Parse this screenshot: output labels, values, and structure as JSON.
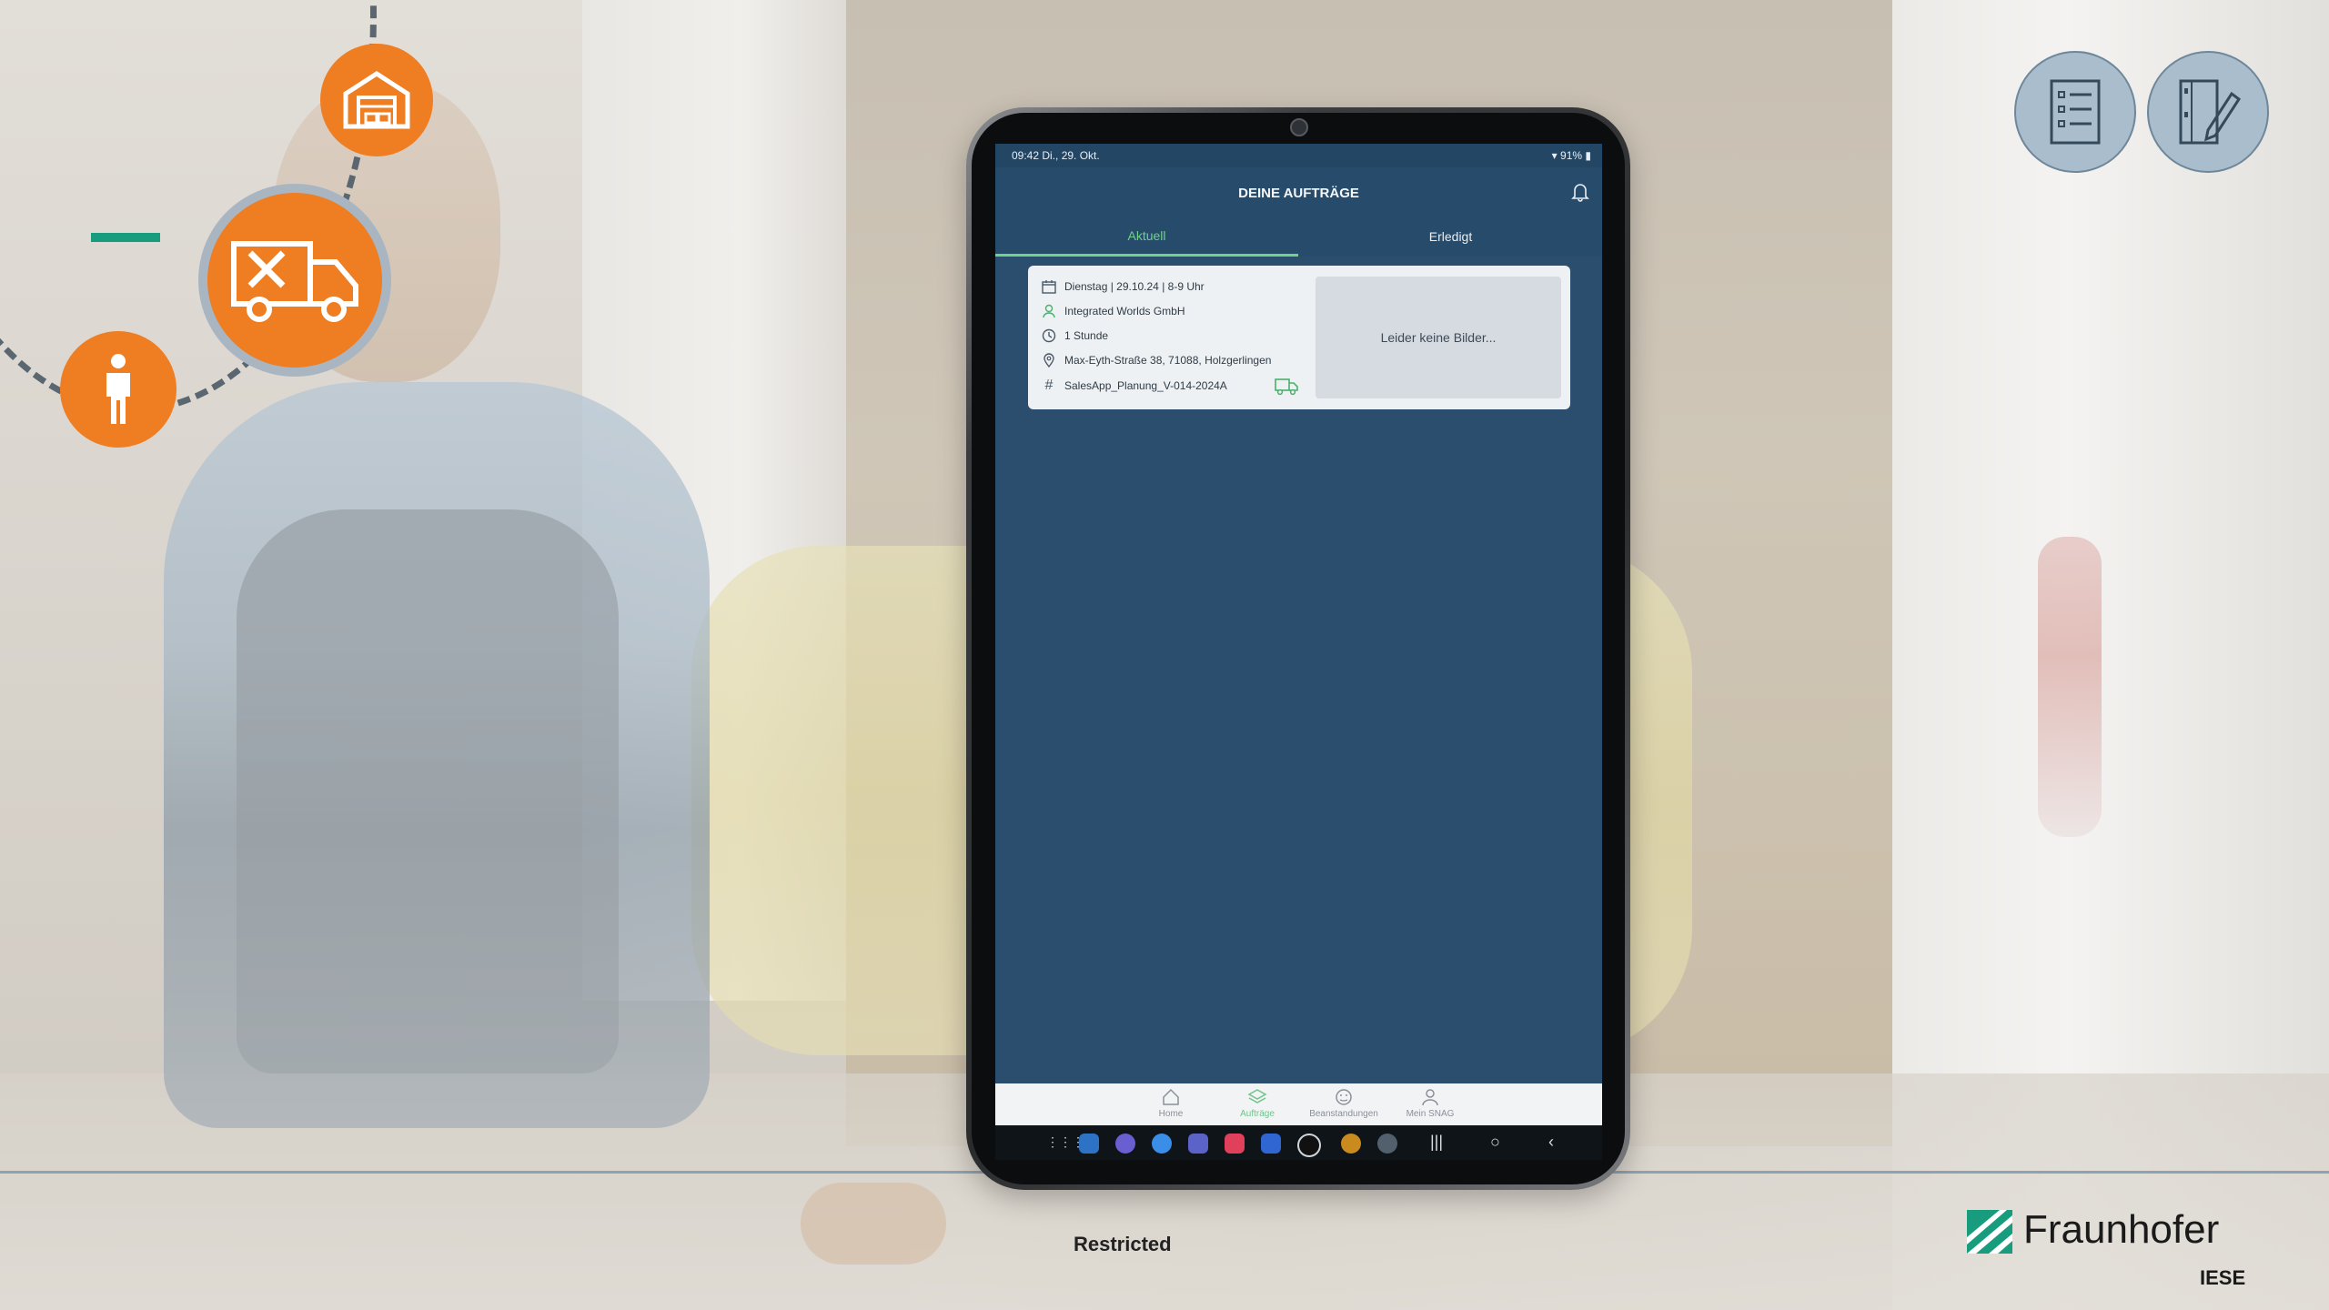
{
  "slide": {
    "restricted_label": "Restricted",
    "logo_name": "Fraunhofer",
    "logo_sub": "IESE"
  },
  "colors": {
    "orange": "#ef7d22",
    "fraunhofer_green": "#179c7d",
    "app_blue": "#2b4e6e",
    "accent_green": "#6fd28b"
  },
  "process_icons": [
    "warehouse-icon",
    "service-van-icon",
    "person-icon"
  ],
  "corner_icons": [
    "checklist-icon",
    "document-edit-icon"
  ],
  "tablet": {
    "status": {
      "time_date": "09:42  Di., 29. Okt.",
      "battery": "91%"
    },
    "app_title": "DEINE AUFTRÄGE",
    "tabs": [
      {
        "label": "Aktuell",
        "active": true
      },
      {
        "label": "Erledigt",
        "active": false
      }
    ],
    "order": {
      "date": "Dienstag | 29.10.24 | 8-9 Uhr",
      "customer": "Integrated Worlds GmbH",
      "duration": "1 Stunde",
      "address": "Max-Eyth-Straße 38, 71088, Holzgerlingen",
      "reference": "SalesApp_Planung_V-014-2024A",
      "no_images": "Leider keine Bilder..."
    },
    "bottom_nav": [
      {
        "label": "Home",
        "active": false
      },
      {
        "label": "Aufträge",
        "active": true
      },
      {
        "label": "Beanstandungen",
        "active": false
      },
      {
        "label": "Mein SNAG",
        "active": false
      }
    ]
  }
}
